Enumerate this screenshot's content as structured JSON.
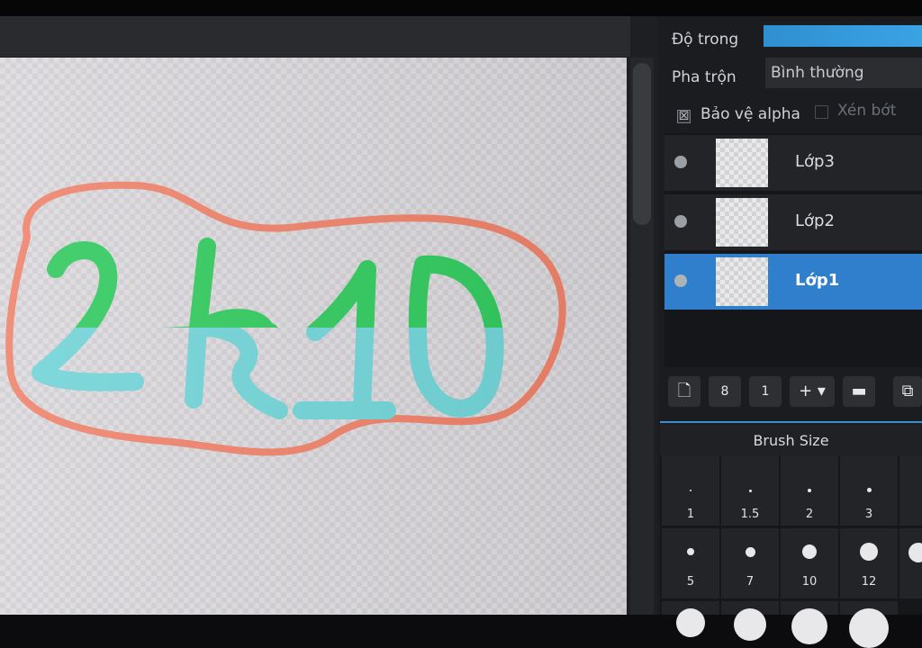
{
  "properties": {
    "opacity_label": "Độ trong",
    "blend_label": "Pha trộn",
    "blend_value": "Bình thường",
    "protect_alpha_label": "Bảo vệ alpha",
    "protect_alpha_checked": true,
    "clip_label": "Xén bớt",
    "clip_checked": false
  },
  "layers": [
    {
      "name": "Lớp3",
      "selected": false
    },
    {
      "name": "Lớp2",
      "selected": false
    },
    {
      "name": "Lớp1",
      "selected": true
    }
  ],
  "layer_toolbar": {
    "checkbox_glyph": "☒",
    "new_layer_icon": "🗋",
    "layer_8bit_icon": "8",
    "layer_1bit_icon": "1",
    "dropdown_arrow": "▾",
    "add_icon": "+",
    "folder_icon": "▬",
    "copy_icon": "⧉"
  },
  "brush_panel": {
    "title": "Brush Size",
    "sizes": [
      "1",
      "1.5",
      "2",
      "3",
      "5",
      "7",
      "10",
      "12"
    ]
  },
  "colors": {
    "accent": "#2f7fcc",
    "stroke_green": "#2fc95c",
    "stroke_cyan": "#6fd3d6",
    "stroke_salmon": "#ee8068"
  }
}
